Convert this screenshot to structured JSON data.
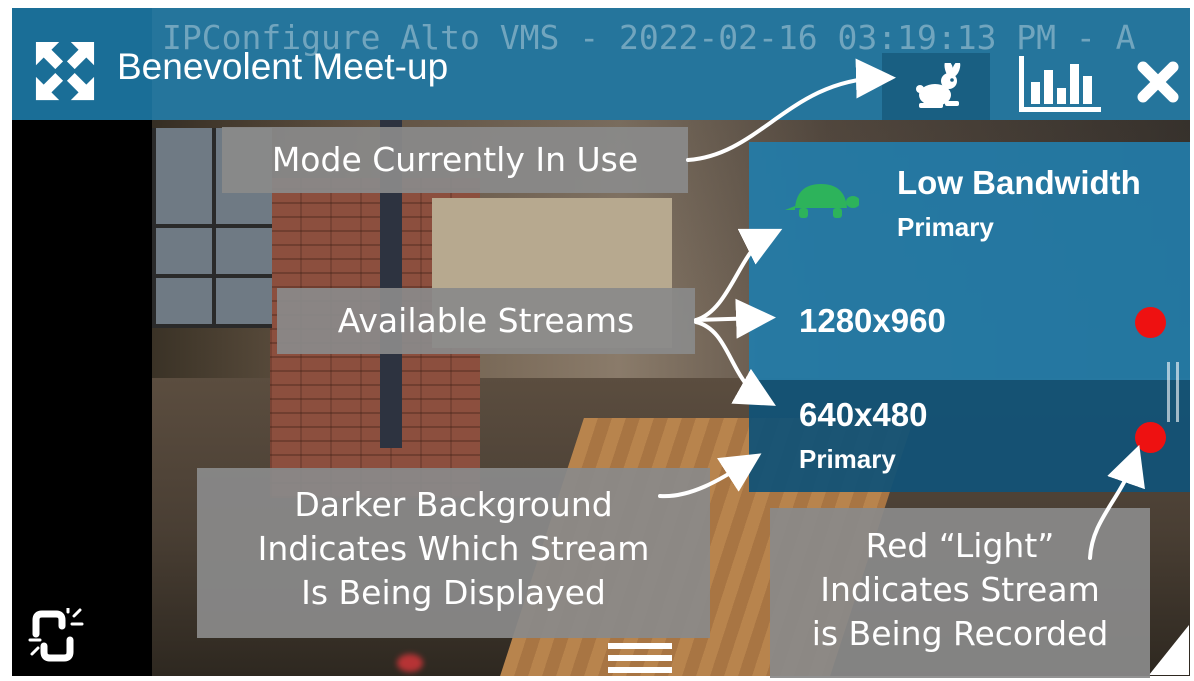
{
  "header": {
    "watermark": "IPConfigure Alto VMS - 2022-02-16 03:19:13 PM - A",
    "title": "Benevolent Meet-up",
    "fullscreen_icon": "expand-arrows-icon",
    "mode_icon": "rabbit-icon",
    "stats_icon": "bar-chart-icon",
    "close_icon": "close-icon"
  },
  "streams": [
    {
      "name": "Low Bandwidth",
      "sub": "Primary",
      "icon": "turtle-icon",
      "recording": false,
      "selected": false
    },
    {
      "name": "1280x960",
      "sub": "",
      "recording": true,
      "selected": false
    },
    {
      "name": "640x480",
      "sub": "Primary",
      "recording": true,
      "selected": true
    }
  ],
  "callouts": {
    "mode": "Mode Currently In Use",
    "available": "Available Streams",
    "darker_1": "Darker Background",
    "darker_2": "Indicates Which Stream",
    "darker_3": "Is Being Displayed",
    "red_1": "Red “Light”",
    "red_2": "Indicates Stream",
    "red_3": "is Being Recorded"
  },
  "footer": {
    "unlink_icon": "broken-link-icon",
    "menu_icon": "hamburger-icon",
    "resize_icon": "resize-corner-icon"
  },
  "colors": {
    "header": "#1a6e97",
    "stream_row": "#227ca9",
    "stream_row_selected": "#125276",
    "turtle": "#2db35b",
    "record_dot": "#ee1111",
    "callout_bg": "#8a8a8a"
  }
}
